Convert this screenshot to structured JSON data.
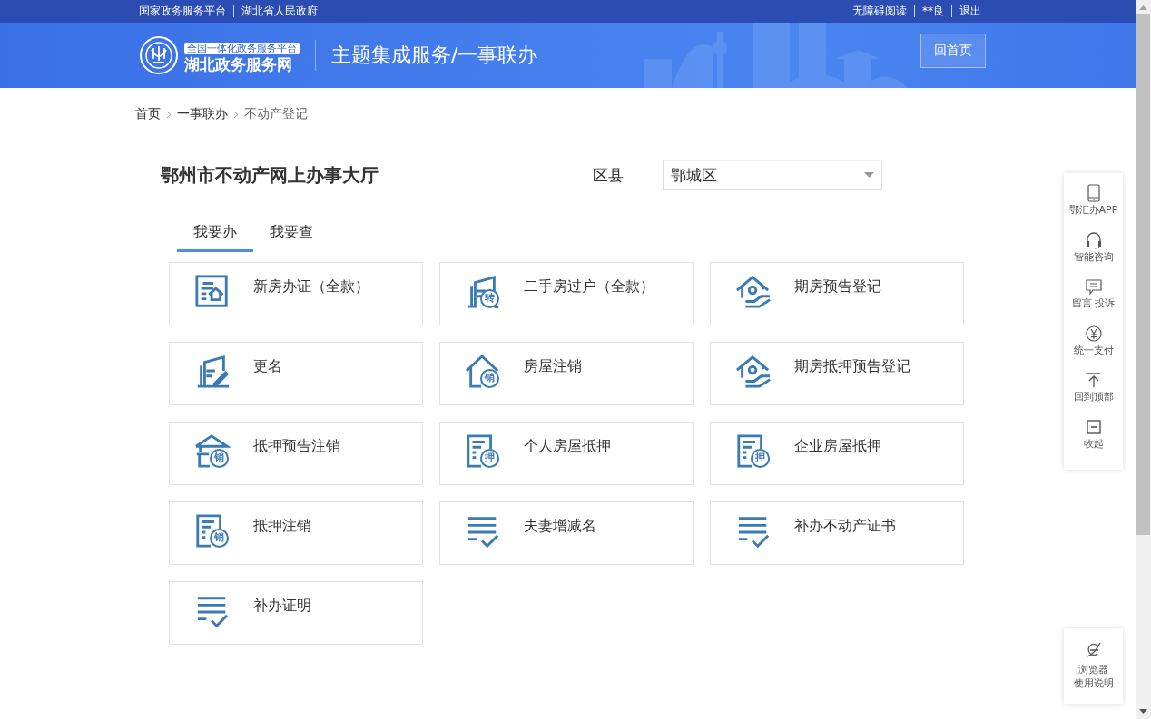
{
  "top_bar": {
    "left_links": [
      "国家政务服务平台",
      "湖北省人民政府"
    ],
    "right_links": [
      "无障碍阅读",
      "**良",
      "退出"
    ]
  },
  "banner": {
    "logo_tagline": "全国一体化政务服务平台",
    "logo_name": "湖北政务服务网",
    "title": "主题集成服务/一事联办",
    "home_button": "回首页"
  },
  "breadcrumb": [
    "首页",
    "一事联办",
    "不动产登记"
  ],
  "hall": {
    "title": "鄂州市不动产网上办事大厅",
    "district_label": "区县",
    "district_value": "鄂城区"
  },
  "tabs": [
    {
      "label": "我要办",
      "selected": true
    },
    {
      "label": "我要查",
      "selected": false
    }
  ],
  "services": [
    {
      "label": "新房办证（全款）",
      "kind": "doc-house"
    },
    {
      "label": "二手房过户（全款）",
      "kind": "folder-badge",
      "badge": "转"
    },
    {
      "label": "期房预告登记",
      "kind": "house-hand"
    },
    {
      "label": "更名",
      "kind": "folder-pen"
    },
    {
      "label": "房屋注销",
      "kind": "house-badge",
      "badge": "销"
    },
    {
      "label": "期房抵押预告登记",
      "kind": "house-hand"
    },
    {
      "label": "抵押预告注销",
      "kind": "roof-badge",
      "badge": "销"
    },
    {
      "label": "个人房屋抵押",
      "kind": "doc-badge",
      "badge": "押"
    },
    {
      "label": "企业房屋抵押",
      "kind": "doc-badge",
      "badge": "押"
    },
    {
      "label": "抵押注销",
      "kind": "doc-badge",
      "badge": "销"
    },
    {
      "label": "夫妻增减名",
      "kind": "list-check"
    },
    {
      "label": "补办不动产证书",
      "kind": "list-check"
    },
    {
      "label": "补办证明",
      "kind": "list-check"
    }
  ],
  "side_tools": [
    {
      "label": "鄂汇办APP",
      "kind": "phone"
    },
    {
      "label": "智能咨询",
      "kind": "headset"
    },
    {
      "label": "留言 投诉",
      "kind": "chat"
    },
    {
      "label": "统一支付",
      "kind": "yen"
    },
    {
      "label": "回到顶部",
      "kind": "to-top"
    },
    {
      "label": "收起",
      "kind": "collapse"
    }
  ],
  "browser_help": {
    "label_lines": [
      "浏览器",
      "使用说明"
    ]
  }
}
